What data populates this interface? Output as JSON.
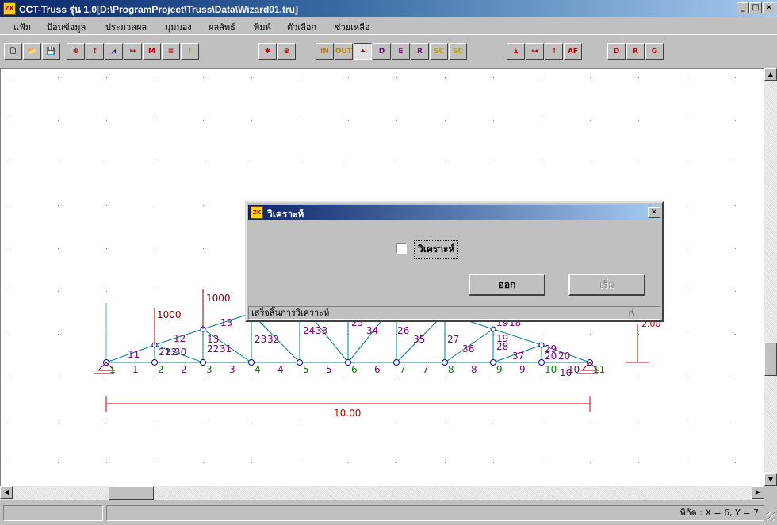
{
  "window": {
    "title": "CCT-Truss รุ่น 1.0[D:\\ProgramProject\\Truss\\Data\\Wizard01.tru]",
    "app_icon_text": "ZK",
    "min_glyph": "_",
    "max_glyph": "□",
    "close_glyph": "×"
  },
  "menu": [
    "แฟ้ม",
    "ป้อนข้อมูล",
    "ประมวลผล",
    "มุมมอง",
    "ผลลัพธ์",
    "พิมพ์",
    "ตัวเลือก",
    "ช่วยเหลือ"
  ],
  "toolbar": {
    "buttons": [
      {
        "name": "new-file-icon",
        "glyph": "🗋",
        "color": "#000000"
      },
      {
        "name": "open-file-icon",
        "glyph": "📂",
        "color": "#806000"
      },
      {
        "name": "save-file-icon",
        "glyph": "💾",
        "color": "#000080"
      },
      {
        "name": "node-icon",
        "glyph": "⊕",
        "color": "#c00000"
      },
      {
        "name": "member-icon",
        "glyph": "↕",
        "color": "#c00000"
      },
      {
        "name": "support-icon",
        "glyph": "⩘",
        "color": "#0000c0"
      },
      {
        "name": "load-icon",
        "glyph": "↦",
        "color": "#c00000"
      },
      {
        "name": "moment-icon",
        "glyph": "M",
        "color": "#c00000"
      },
      {
        "name": "material-icon",
        "glyph": "≡",
        "color": "#c00000"
      },
      {
        "name": "warning-icon",
        "glyph": "!",
        "color": "#c0a000"
      },
      {
        "name": "analyze-icon",
        "glyph": "✱",
        "color": "#c00000"
      },
      {
        "name": "reaction-icon",
        "glyph": "⊛",
        "color": "#c00000"
      },
      {
        "name": "zoom-in-icon",
        "glyph": "IN",
        "color": "#c08000"
      },
      {
        "name": "zoom-out-icon",
        "glyph": "OUT",
        "color": "#c08000"
      },
      {
        "name": "truss-view-icon",
        "glyph": "⏶",
        "color": "#c00000"
      },
      {
        "name": "d-axis-icon",
        "glyph": "D",
        "color": "#800080"
      },
      {
        "name": "e-axis-icon",
        "glyph": "E",
        "color": "#800080"
      },
      {
        "name": "r-axis-icon",
        "glyph": "R",
        "color": "#800080"
      },
      {
        "name": "scale-up-icon",
        "glyph": "SC",
        "color": "#c0a000"
      },
      {
        "name": "scale-down-icon",
        "glyph": "SC",
        "color": "#c0a000"
      },
      {
        "name": "truss-icon",
        "glyph": "⩓",
        "color": "#c00000"
      },
      {
        "name": "dimension-icon",
        "glyph": "⊶",
        "color": "#c00000"
      },
      {
        "name": "force-icon",
        "glyph": "⇑",
        "color": "#c00000"
      },
      {
        "name": "after-icon",
        "glyph": "AF",
        "color": "#c00000"
      },
      {
        "name": "report-d-icon",
        "glyph": "D",
        "color": "#c00000"
      },
      {
        "name": "report-r-icon",
        "glyph": "R",
        "color": "#c00000"
      },
      {
        "name": "report-g-icon",
        "glyph": "G",
        "color": "#c00000"
      }
    ]
  },
  "dialog": {
    "title": "วิเคราะห์",
    "icon_text": "ZK",
    "close_glyph": "×",
    "checkbox_label": "วิเคราะห์",
    "checkbox_checked": false,
    "exit_button": "ออก",
    "start_button": "เริ่ม",
    "status": "เสร็จสิ้นการวิเคราะห์"
  },
  "statusbar": {
    "coordinates": "พิกัด : X = 6, Y = 7"
  },
  "truss": {
    "loads": [
      "1000",
      "1000"
    ],
    "dimension_label": "10.00",
    "right_support_value": "2.00",
    "node_labels": [
      "1",
      "2",
      "3",
      "4",
      "5",
      "6",
      "7",
      "8",
      "9",
      "10",
      "11"
    ],
    "bottom_member_labels": [
      "1",
      "2",
      "3",
      "4",
      "5",
      "6",
      "7",
      "8",
      "9",
      "10"
    ],
    "diagonal_labels": [
      "11",
      "12",
      "13",
      "21",
      "22",
      "30",
      "13",
      "22",
      "31",
      "23",
      "32",
      "24",
      "33",
      "25",
      "34",
      "26",
      "35",
      "27",
      "36",
      "19",
      "28",
      "37",
      "20",
      "20",
      "29",
      "10",
      "19",
      "18"
    ],
    "colors": {
      "member": "#008080",
      "node_label": "#008000",
      "member_label": "#800080",
      "load": "#800000",
      "dimension": "#c00000",
      "node": "#0000c0",
      "grid_dot": "#808080"
    }
  }
}
